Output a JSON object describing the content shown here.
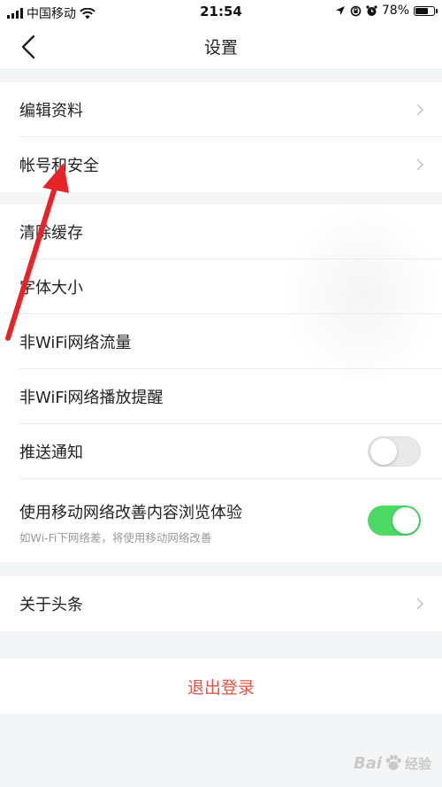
{
  "status_bar": {
    "carrier": "中国移动",
    "time": "21:54",
    "battery_percent": "78%",
    "battery_level": 0.78
  },
  "nav": {
    "title": "设置"
  },
  "groups": {
    "account": [
      {
        "label": "编辑资料"
      },
      {
        "label": "帐号和安全"
      }
    ],
    "general": [
      {
        "label": "清除缓存"
      },
      {
        "label": "字体大小"
      },
      {
        "label": "非WiFi网络流量"
      },
      {
        "label": "非WiFi网络播放提醒"
      },
      {
        "label": "推送通知",
        "toggle": false
      },
      {
        "label": "使用移动网络改善内容浏览体验",
        "sublabel": "如Wi-Fi下网络差，将使用移动网络改善",
        "toggle": true
      }
    ],
    "about": [
      {
        "label": "关于头条"
      }
    ]
  },
  "logout": {
    "label": "退出登录"
  },
  "colors": {
    "toggle_on": "#4cd964",
    "logout_text": "#e05449",
    "annotation_arrow": "#e8242b"
  },
  "watermark": {
    "text_latin": "Bai",
    "text_cn": "经验"
  }
}
